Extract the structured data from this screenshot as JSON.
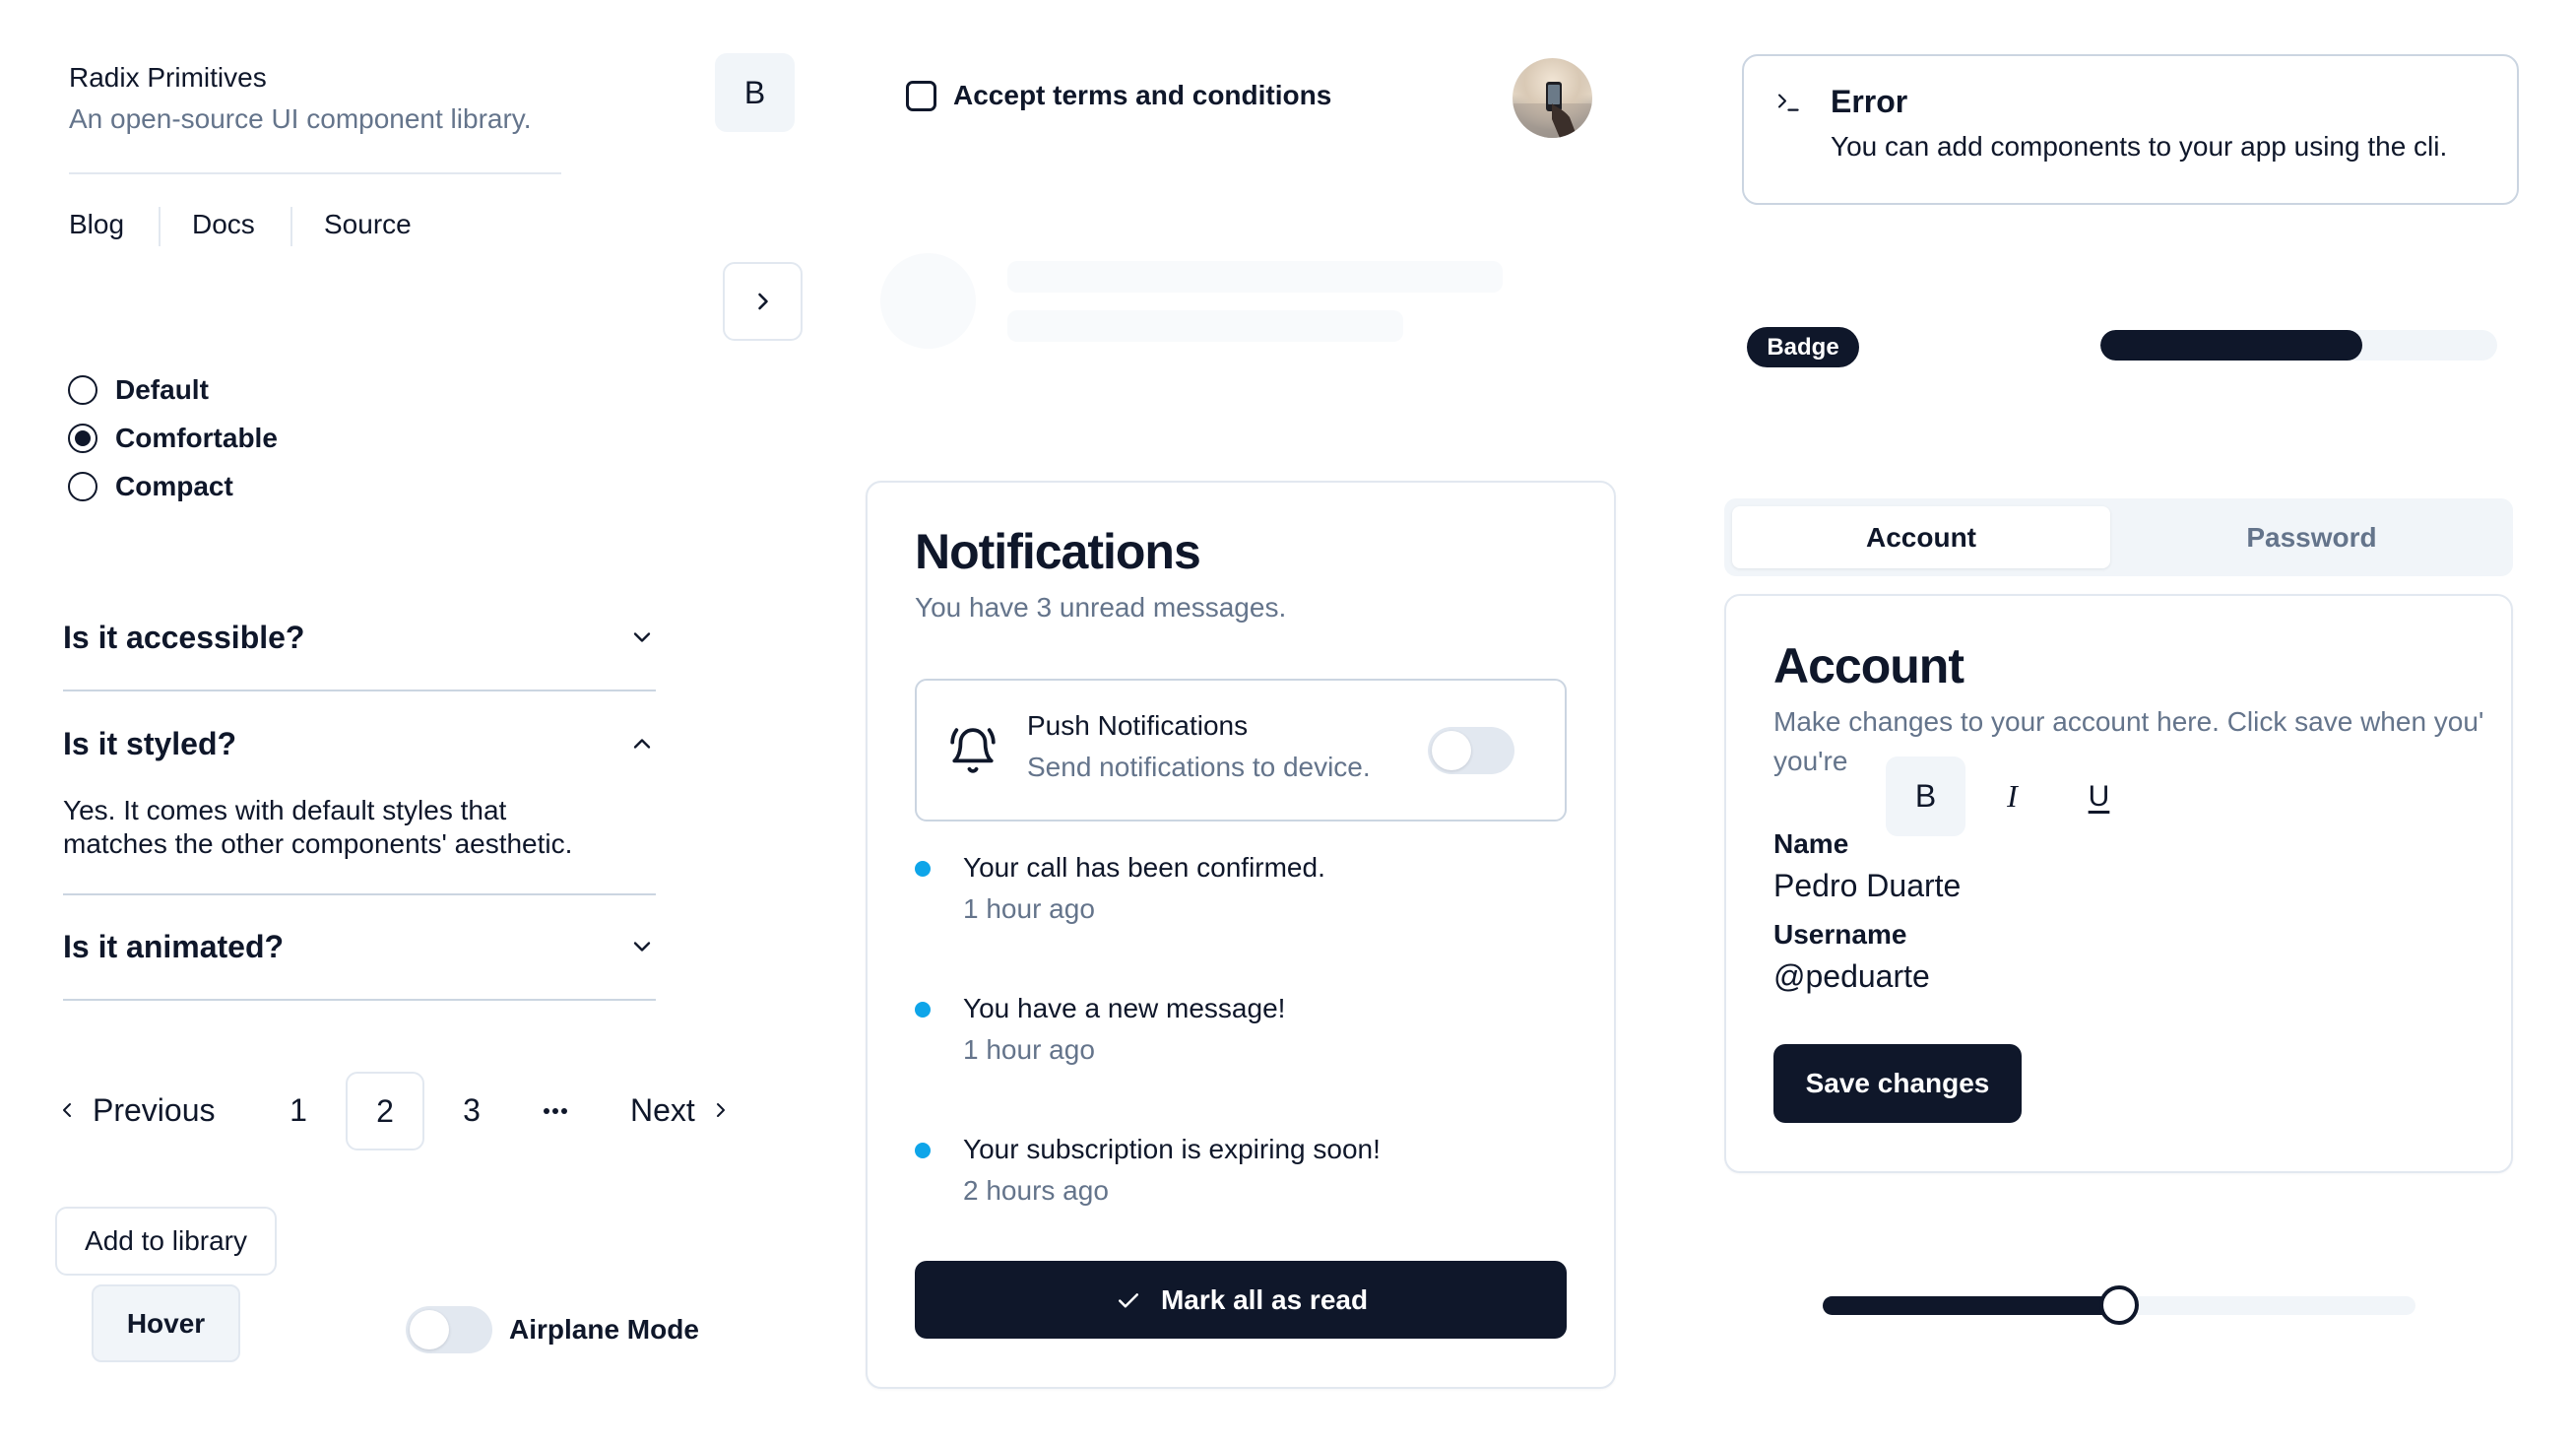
{
  "hover_card": {
    "title": "Radix Primitives",
    "subtitle": "An open-source UI component library.",
    "links": [
      "Blog",
      "Docs",
      "Source"
    ]
  },
  "bold_toggle": {
    "label": "B",
    "pressed": true
  },
  "next_icon_button": {
    "icon": "chevron-right-icon"
  },
  "radio_group": {
    "options": [
      "Default",
      "Comfortable",
      "Compact"
    ],
    "selected": "Comfortable"
  },
  "accordion": {
    "items": [
      {
        "question": "Is it accessible?",
        "expanded": false,
        "answer": ""
      },
      {
        "question": "Is it styled?",
        "expanded": true,
        "answer_lines": [
          "Yes. It comes with default styles that",
          "matches the other components' aesthetic."
        ]
      },
      {
        "question": "Is it animated?",
        "expanded": false,
        "answer": ""
      }
    ]
  },
  "pagination": {
    "previous": "Previous",
    "pages": [
      "1",
      "2",
      "3"
    ],
    "current": "2",
    "ellipsis": "…",
    "next": "Next"
  },
  "buttons": {
    "add_to_library": "Add to library",
    "hover": "Hover"
  },
  "airplane_mode": {
    "label": "Airplane Mode",
    "checked": false
  },
  "checkbox": {
    "label": "Accept terms and conditions",
    "checked": false
  },
  "avatar": {
    "alt": "user avatar photo"
  },
  "notifications": {
    "title": "Notifications",
    "subtitle": "You have 3 unread messages.",
    "push": {
      "title": "Push Notifications",
      "description": "Send notifications to device.",
      "enabled": false
    },
    "items": [
      {
        "title": "Your call has been confirmed.",
        "time": "1 hour ago"
      },
      {
        "title": "You have a new message!",
        "time": "1 hour ago"
      },
      {
        "title": "Your subscription is expiring soon!",
        "time": "2 hours ago"
      }
    ],
    "mark_all_label": "Mark all as read",
    "accent": "#0ea5e9"
  },
  "alert": {
    "title": "Error",
    "description": "You can add components to your app using the cli."
  },
  "badge": {
    "label": "Badge"
  },
  "progress": {
    "value_percent": 66
  },
  "tabs": {
    "items": [
      "Account",
      "Password"
    ],
    "active": "Account"
  },
  "account": {
    "title": "Account",
    "description": "Make changes to your account here. Click save when you're",
    "format_toolbar": {
      "bold": "B",
      "italic": "I",
      "underline": "U"
    },
    "name_label": "Name",
    "name_value": "Pedro Duarte",
    "username_label": "Username",
    "username_value": "@peduarte",
    "save_label": "Save changes"
  },
  "slider": {
    "value_percent": 50
  },
  "colors": {
    "primary": "#0f172a",
    "muted_text": "#64748b",
    "border": "#e2e8f0",
    "muted_bg": "#f1f5f9",
    "accent_dot": "#0ea5e9"
  }
}
